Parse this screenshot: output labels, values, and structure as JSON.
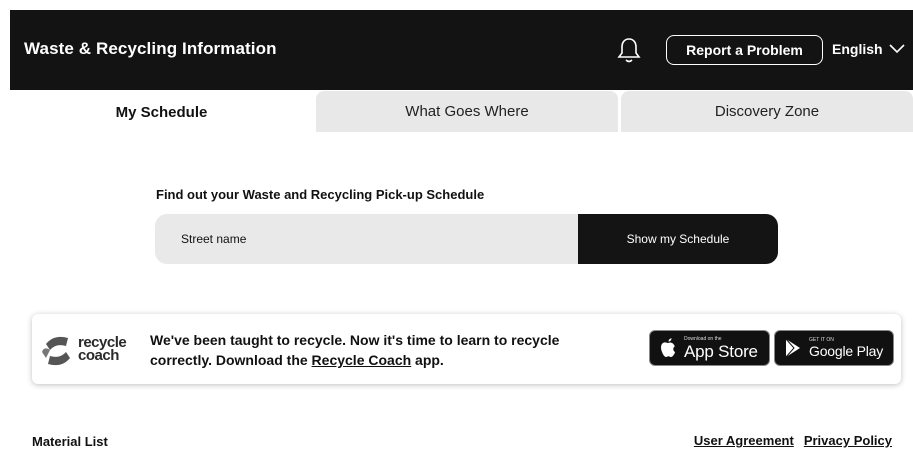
{
  "header": {
    "title": "Waste & Recycling Information",
    "report_label": "Report a Problem",
    "language": "English",
    "bell_icon": "bell-icon",
    "language_icon": "chevron-down-icon",
    "background_color": "#131313"
  },
  "tabs": [
    {
      "label": "My Schedule",
      "active": true
    },
    {
      "label": "What Goes Where",
      "active": false
    },
    {
      "label": "Discovery Zone",
      "active": false
    }
  ],
  "schedule": {
    "heading": "Find out your Waste and Recycling Pick-up Schedule",
    "street_placeholder": "Street name",
    "button_label": "Show my Schedule"
  },
  "banner": {
    "logo_top": "recycle",
    "logo_bottom": "coach",
    "text_before": "We've been taught to recycle. Now it's time to learn to recycle correctly. Download the ",
    "link_text": "Recycle Coach",
    "text_after": " app.",
    "app_store_small": "Download on the",
    "app_store_big": "App Store",
    "google_play_small": "GET IT ON",
    "google_play_big": "Google Play"
  },
  "footer": {
    "material_list": "Material List",
    "user_agreement": "User Agreement",
    "privacy_policy": "Privacy Policy"
  }
}
